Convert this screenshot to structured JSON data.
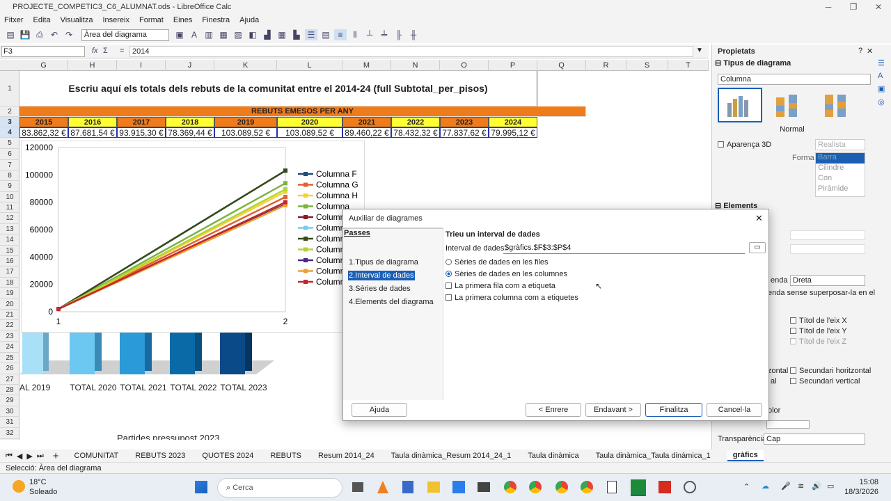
{
  "window": {
    "title": "PROJECTE_COMPETIC3_C6_ALUMNAT.ods - LibreOffice Calc"
  },
  "menu": [
    "Fitxer",
    "Edita",
    "Visualitza",
    "Insereix",
    "Format",
    "Eines",
    "Finestra",
    "Ajuda"
  ],
  "toolbar": {
    "area_combo": "Àrea del diagrama"
  },
  "formula": {
    "cell_ref": "F3",
    "content": "2014",
    "fx": "fx",
    "sigma": "Σ",
    "eq": "="
  },
  "columns": [
    "G",
    "H",
    "I",
    "J",
    "K",
    "L",
    "M",
    "N",
    "O",
    "P",
    "Q",
    "R",
    "S",
    "T"
  ],
  "rows": [
    "1",
    "2",
    "3",
    "4",
    "5",
    "6",
    "7",
    "8",
    "9",
    "10",
    "11",
    "12",
    "13",
    "14",
    "15",
    "16",
    "17",
    "18",
    "19",
    "20",
    "21",
    "22",
    "23",
    "24",
    "25",
    "26",
    "27",
    "28",
    "29",
    "30",
    "31",
    "32"
  ],
  "sheet": {
    "heading": "Escriu aquí els totals dels rebuts de la comunitat entre el 2014-24 (full Subtotal_per_pisos)",
    "banner": "REBUTS EMESOS PER ANY",
    "years": [
      "2015",
      "2016",
      "2017",
      "2018",
      "2019",
      "2020",
      "2021",
      "2022",
      "2023",
      "2024"
    ],
    "amounts": [
      "83.862,32 €",
      "87.681,54 €",
      "93.915,30 €",
      "78.369,44 €",
      "103.089,52 €",
      "103.089,52 €",
      "89.460,22 €",
      "78.432,32 €",
      "77.837,62 €",
      "79.995,12 €"
    ],
    "bar_labels": [
      "AL 2019",
      "TOTAL 2020",
      "TOTAL 2021",
      "TOTAL 2022",
      "TOTAL 2023"
    ],
    "footer_text": "Partides pressupost 2023"
  },
  "chart_data": {
    "type": "line",
    "x": [
      "1",
      "2"
    ],
    "ylim": [
      0,
      120000
    ],
    "yticks": [
      "120000",
      "100000",
      "80000",
      "60000",
      "40000",
      "20000",
      "0"
    ],
    "legend_position": "right",
    "series": [
      {
        "name": "Columna F",
        "values": [
          2014,
          103089
        ],
        "color": "#1f4e79"
      },
      {
        "name": "Columna G",
        "values": [
          2015,
          83862
        ],
        "color": "#e06030"
      },
      {
        "name": "Columna H",
        "values": [
          2016,
          87681
        ],
        "color": "#f2d23a"
      },
      {
        "name": "Columna",
        "values": [
          2017,
          93915
        ],
        "color": "#7cb342"
      },
      {
        "name": "Columna",
        "values": [
          2018,
          78369
        ],
        "color": "#8b1a2b"
      },
      {
        "name": "Columna",
        "values": [
          2019,
          103089
        ],
        "color": "#7ec8f0"
      },
      {
        "name": "Columna",
        "values": [
          2020,
          103089
        ],
        "color": "#3a4a18"
      },
      {
        "name": "Columna",
        "values": [
          2021,
          89460
        ],
        "color": "#b5d334"
      },
      {
        "name": "Columna",
        "values": [
          2022,
          78432
        ],
        "color": "#4b2a80"
      },
      {
        "name": "Columna",
        "values": [
          2023,
          77837
        ],
        "color": "#f0a030"
      },
      {
        "name": "Columna",
        "values": [
          2024,
          79995
        ],
        "color": "#c0282d"
      }
    ]
  },
  "dialog": {
    "title": "Auxiliar de diagrames",
    "steps_header": "Passes",
    "steps": [
      "1.Tipus de diagrama",
      "2.Interval de dades",
      "3.Sèries de dades",
      "4.Elements del diagrama"
    ],
    "section_title": "Trieu un interval de dades",
    "range_label": "Interval de dades:",
    "range_value": "$gràfics.$F$3:$P$4",
    "opt_rows": "Sèries de dades en les files",
    "opt_cols": "Sèries de dades en les columnes",
    "chk_first_row": "La primera fila com a etiqueta",
    "chk_first_col": "La primera columna com a etiquetes",
    "btn_help": "Ajuda",
    "btn_back": "< Enrere",
    "btn_next": "Endavant >",
    "btn_finish": "Finalitza",
    "btn_cancel": "Cancel·la"
  },
  "sidebar": {
    "title": "Propietats",
    "chart_type_header": "Tipus de diagrama",
    "chart_type_value": "Columna",
    "subtype_label": "Normal",
    "appearance_3d": "Aparença 3D",
    "realista": "Realista",
    "forma_label": "Forma",
    "shapes": [
      "Barra",
      "Cilindre",
      "Con",
      "Piràmide"
    ],
    "elements_header": "Elements",
    "legend_label_part": "enda",
    "legend_value": "Dreta",
    "legend_overlay": "enda sense superposar-la en el",
    "axis_x": "Títol de l'eix X",
    "axis_y": "Títol de l'eix Y",
    "axis_z": "Títol de l'eix Z",
    "sec_h_part": "zontal",
    "sec_h": "Secundari horitzontal",
    "sec_v_part": "al",
    "sec_v": "Secundari vertical",
    "color_label": "olor",
    "transparency_label": "Transparència:",
    "transparency_value": "Cap"
  },
  "tabs": [
    "COMUNITAT",
    "REBUTS 2023",
    "QUOTES 2024",
    "REBUTS",
    "Resum 2014_24",
    "Taula dinàmica_Resum 2014_24_1",
    "Taula dinàmica",
    "Taula dinàmica_Taula dinàmica_1",
    "gràfics"
  ],
  "status": "Selecció: Àrea del diagrama",
  "taskbar": {
    "temp": "18°C",
    "weather": "Soleado",
    "search": "Cerca",
    "time": "15:08",
    "date": "18/3/2026"
  }
}
